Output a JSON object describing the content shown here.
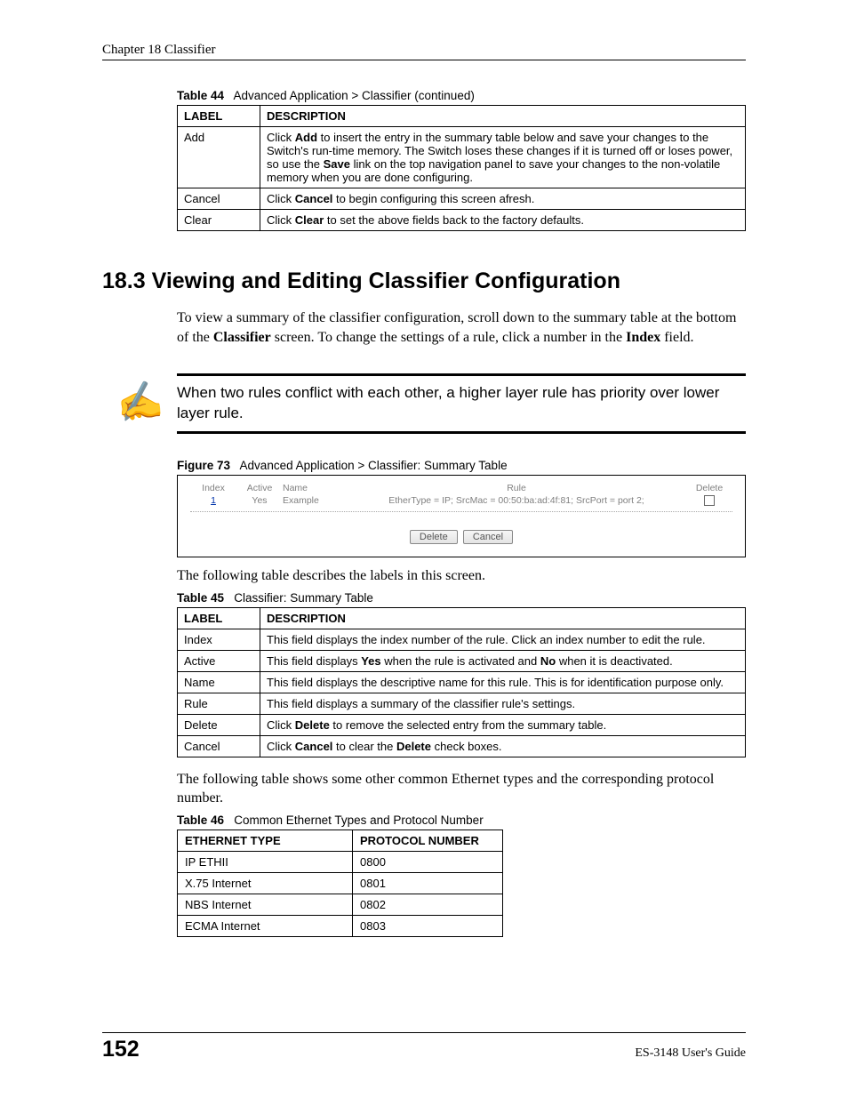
{
  "header": {
    "chapter": "Chapter 18 Classifier"
  },
  "table44": {
    "caption_prefix": "Table 44",
    "caption": "Advanced Application > Classifier  (continued)",
    "head": {
      "label": "LABEL",
      "desc": "DESCRIPTION"
    },
    "rows": [
      {
        "label": "Add",
        "desc_html": "Click <b>Add</b> to insert the entry in the summary table below and save your changes to the Switch's run-time memory. The Switch loses these changes if it is turned off or loses power, so use the <b>Save</b> link on the top navigation panel to save your changes to the non-volatile memory when you are done configuring."
      },
      {
        "label": "Cancel",
        "desc_html": "Click <b>Cancel</b> to begin configuring this screen afresh."
      },
      {
        "label": "Clear",
        "desc_html": "Click <b>Clear</b> to set the above fields back to the factory defaults."
      }
    ]
  },
  "section": {
    "title": "18.3  Viewing and Editing Classifier Configuration",
    "intro_html": "To view a summary of the classifier configuration, scroll down to the summary table at the bottom of the <b>Classifier</b> screen. To change the settings of a rule, click a number in the <b>Index</b> field."
  },
  "note": {
    "text": "When two rules conflict with each other, a higher layer rule has priority over lower layer rule."
  },
  "figure73": {
    "caption_prefix": "Figure 73",
    "caption": "Advanced Application > Classifier: Summary Table",
    "head": {
      "index": "Index",
      "active": "Active",
      "name": "Name",
      "rule": "Rule",
      "delete": "Delete"
    },
    "row": {
      "index": "1",
      "active": "Yes",
      "name": "Example",
      "rule": "EtherType = IP; SrcMac = 00:50:ba:ad:4f:81; SrcPort = port 2;"
    },
    "btns": {
      "delete": "Delete",
      "cancel": "Cancel"
    }
  },
  "after_fig": "The following table describes the labels in this screen.",
  "table45": {
    "caption_prefix": "Table 45",
    "caption": "Classifier: Summary Table",
    "head": {
      "label": "LABEL",
      "desc": "DESCRIPTION"
    },
    "rows": [
      {
        "label": "Index",
        "desc_html": "This field displays the index number of the rule. Click an index number to edit the rule."
      },
      {
        "label": "Active",
        "desc_html": "This field displays <b>Yes</b> when the rule is activated and <b>No</b> when it is deactivated."
      },
      {
        "label": "Name",
        "desc_html": "This field displays the descriptive name for this rule. This is for identification purpose only."
      },
      {
        "label": "Rule",
        "desc_html": "This field displays a summary of the classifier rule's settings."
      },
      {
        "label": "Delete",
        "desc_html": "Click <b>Delete</b> to remove the selected entry from the summary table."
      },
      {
        "label": "Cancel",
        "desc_html": "Click <b>Cancel</b> to clear the <b>Delete</b> check boxes."
      }
    ]
  },
  "after_t45": "The following table shows some other common Ethernet types and the corresponding protocol number.",
  "table46": {
    "caption_prefix": "Table 46",
    "caption": "Common Ethernet Types and Protocol Number",
    "head": {
      "etype": "ETHERNET TYPE",
      "proto": "PROTOCOL NUMBER"
    },
    "rows": [
      {
        "etype": "IP ETHII",
        "proto": "0800"
      },
      {
        "etype": "X.75 Internet",
        "proto": "0801"
      },
      {
        "etype": "NBS Internet",
        "proto": "0802"
      },
      {
        "etype": "ECMA Internet",
        "proto": "0803"
      }
    ]
  },
  "footer": {
    "page": "152",
    "guide": "ES-3148 User's Guide"
  }
}
